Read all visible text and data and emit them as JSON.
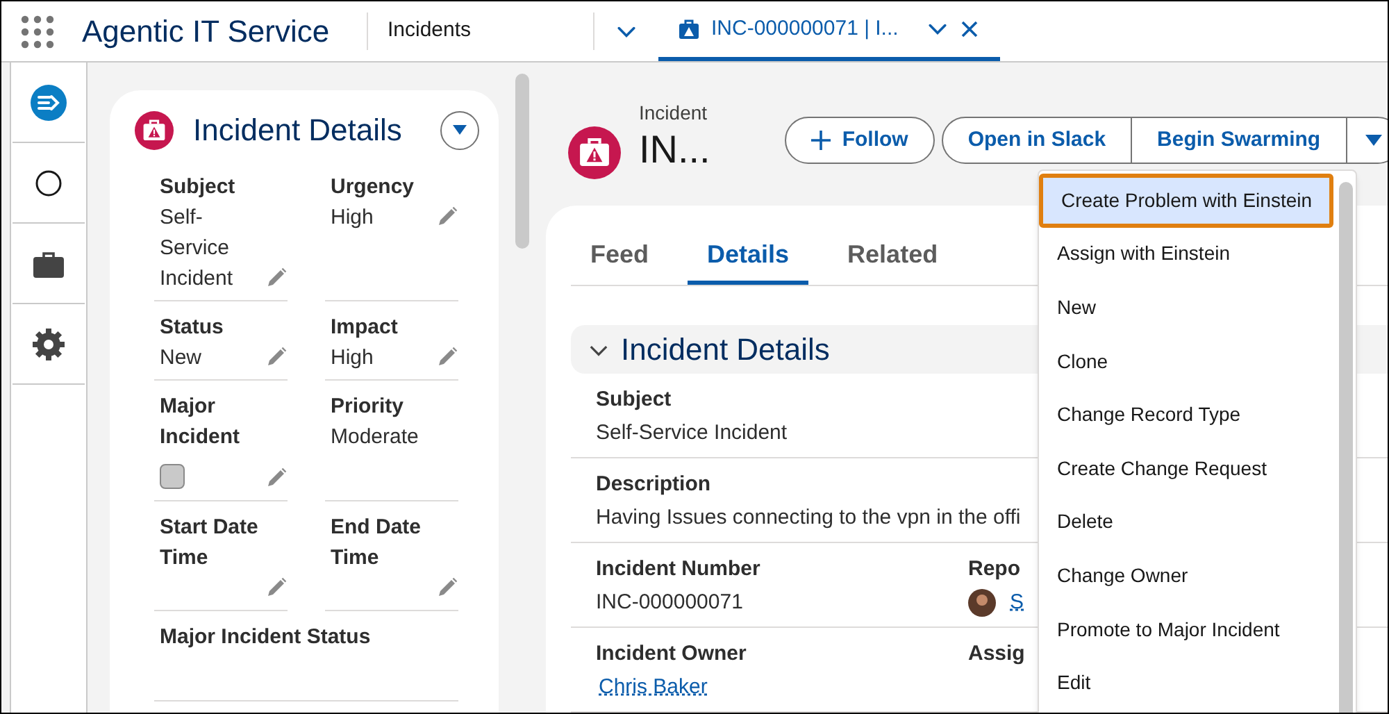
{
  "app": {
    "title": "Agentic IT Service"
  },
  "nav": {
    "label": "Incidents"
  },
  "tabs": [
    {
      "label": "INC-000000071 | I...",
      "selected": true
    }
  ],
  "left_card": {
    "title": "Incident Details",
    "fields": [
      {
        "label": "Subject",
        "value": "Self-Service Incident",
        "kind": "text",
        "editable": true
      },
      {
        "label": "Urgency",
        "value": "High",
        "kind": "text",
        "editable": true
      },
      {
        "label": "Status",
        "value": "New",
        "kind": "text",
        "editable": true
      },
      {
        "label": "Impact",
        "value": "High",
        "kind": "text",
        "editable": true
      },
      {
        "label": "Major Incident",
        "kind": "checkbox",
        "checked": false,
        "editable": true
      },
      {
        "label": "Priority",
        "value": "Moderate",
        "kind": "text",
        "editable": false
      },
      {
        "label": "Start Date Time",
        "kind": "text",
        "editable": true
      },
      {
        "label": "End Date Time",
        "kind": "text",
        "editable": true
      },
      {
        "label": "Major Incident Status",
        "kind": "text",
        "editable": false,
        "full_width": true
      }
    ]
  },
  "header": {
    "object": "Incident",
    "name": "IN..."
  },
  "actions": [
    {
      "label": "Follow",
      "kind": "follow"
    },
    {
      "label": "Open in Slack",
      "kind": "group"
    },
    {
      "label": "Begin Swarming",
      "kind": "group"
    }
  ],
  "record_tabs": [
    {
      "label": "Feed",
      "selected": false
    },
    {
      "label": "Details",
      "selected": true
    },
    {
      "label": "Related",
      "selected": false
    }
  ],
  "section": {
    "title": "Incident Details",
    "expanded": true,
    "rows": [
      {
        "left": {
          "label": "Subject",
          "value": "Self-Service Incident"
        }
      },
      {
        "left": {
          "label": "Description",
          "value": "Having Issues connecting to the vpn in the offi"
        }
      },
      {
        "left": {
          "label": "Incident Number",
          "value": "INC-000000071"
        },
        "right": {
          "label": "Repo",
          "link": "S"
        }
      },
      {
        "left": {
          "label": "Incident Owner",
          "link": "Chris Baker"
        },
        "right": {
          "label": "Assig"
        }
      }
    ]
  },
  "menu": [
    {
      "label": "Create Problem with Einstein",
      "selected": true
    },
    {
      "label": "Assign with Einstein",
      "selected": false
    },
    {
      "label": "New",
      "selected": false
    },
    {
      "label": "Clone",
      "selected": false
    },
    {
      "label": "Change Record Type",
      "selected": false
    },
    {
      "label": "Create Change Request",
      "selected": false
    },
    {
      "label": "Delete",
      "selected": false
    },
    {
      "label": "Change Owner",
      "selected": false
    },
    {
      "label": "Promote to Major Incident",
      "selected": false
    },
    {
      "label": "Edit",
      "selected": false
    }
  ]
}
